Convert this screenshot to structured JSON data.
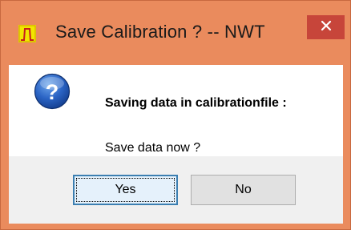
{
  "window": {
    "title": "Save Calibration ? -- NWT",
    "app_icon": "nwt-app-icon",
    "close_icon": "close-icon",
    "close_glyph": "✕",
    "frame_color": "#ea8b5d",
    "close_color": "#c7453a"
  },
  "message": {
    "icon": "question-icon",
    "icon_glyph": "?",
    "heading": "Saving data in calibrationfile :",
    "question": "Save data now ?"
  },
  "buttons": {
    "yes_label": "Yes",
    "no_label": "No"
  }
}
